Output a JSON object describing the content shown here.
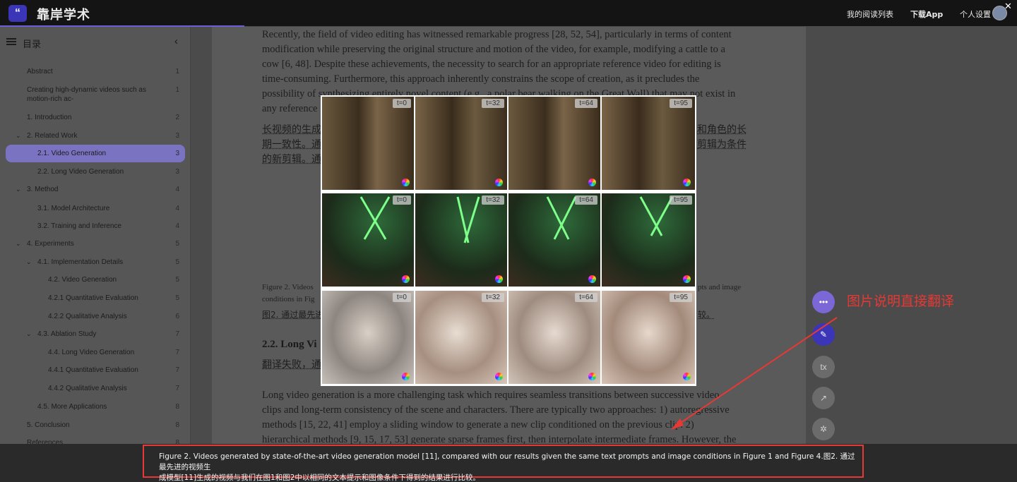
{
  "header": {
    "app_name": "靠岸学术",
    "logo_glyph": "“",
    "reading_list": "我的阅读列表",
    "download_app": "下载App",
    "settings": "个人设置"
  },
  "sidebar": {
    "title": "目录",
    "items": [
      {
        "label": "Abstract",
        "page": "1"
      },
      {
        "label": "Creating high-dynamic videos such as motion-rich ac-",
        "page": "1"
      },
      {
        "label": "1. Introduction",
        "page": "2"
      },
      {
        "label": "2. Related Work",
        "page": "3"
      },
      {
        "label": "2.1. Video Generation",
        "page": "3"
      },
      {
        "label": "2.2. Long Video Generation",
        "page": "3"
      },
      {
        "label": "3. Method",
        "page": "4"
      },
      {
        "label": "3.1. Model Architecture",
        "page": "4"
      },
      {
        "label": "3.2. Training and Inference",
        "page": "4"
      },
      {
        "label": "4. Experiments",
        "page": "5"
      },
      {
        "label": "4.1. Implementation Details",
        "page": "5"
      },
      {
        "label": "4.2. Video Generation",
        "page": "5"
      },
      {
        "label": "4.2.1 Quantitative Evaluation",
        "page": "5"
      },
      {
        "label": "4.2.2 Qualitative Analysis",
        "page": "6"
      },
      {
        "label": "4.3. Ablation Study",
        "page": "7"
      },
      {
        "label": "4.4. Long Video Generation",
        "page": "7"
      },
      {
        "label": "4.4.1 Quantitative Evaluation",
        "page": "7"
      },
      {
        "label": "4.4.2 Qualitative Analysis",
        "page": "7"
      },
      {
        "label": "4.5. More Applications",
        "page": "8"
      },
      {
        "label": "5. Conclusion",
        "page": "8"
      },
      {
        "label": "References",
        "page": "8"
      }
    ]
  },
  "document": {
    "p1_lines": [
      "Recently, the field of video editing has witnessed remarkable progress [28, 52, 54], particularly in terms of content",
      "modification while preserving the original structure and motion of the video, for example, modifying a cattle to a",
      "cow [6, 48]. Despite these achievements, the necessity to search for an appropriate reference video for editing is",
      "time-consuming. Furthermore, this approach inherently constrains the scope of creation, as it precludes the",
      "possibility of synthesizing entirely novel content (e.g., a polar bear walking on the Great Wall) that may not exist in",
      "any reference"
    ],
    "zh1_lines": [
      "长视频的生成",
      "期一致性。通",
      "的新剪辑。通"
    ],
    "zh1_right_lines": [
      "和角色的长",
      "剪辑为条件"
    ],
    "fig_caption_lines": [
      "Figure 2. Videos",
      "conditions in Fig"
    ],
    "fig_caption_right": "pts and image",
    "fig_zh_left": "图2. 通过最先进",
    "fig_zh_right": "较。",
    "section_heading": "2.2. Long Vi",
    "fail_text": "翻译失败，通",
    "p2_lines": [
      "Long video generation is a more challenging task which requires seamless transitions between successive video",
      "clips and long-term consistency of the scene and characters. There are typically two approaches: 1) autoregressive",
      "methods [15, 22, 41] employ a sliding window to generate a new clip conditioned on the previous clip. 2)",
      "hierarchical methods [9, 15, 17, 53] generate sparse frames first, then interpolate intermediate frames. However, the"
    ]
  },
  "figure": {
    "time_labels": [
      "t=0",
      "t=32",
      "t=64",
      "t=95"
    ],
    "rows": [
      "bronze-statues",
      "cat-jedi-lightsabers",
      "girl-portrait-sketch"
    ]
  },
  "annotation": {
    "text": "图片说明直接翻译"
  },
  "tools": [
    "chat-icon",
    "magic-wand-icon",
    "translate-icon",
    "open-external-icon",
    "bug-icon"
  ],
  "tools_tx_label": "tx",
  "bottom_caption": {
    "line1": "Figure 2. Videos generated by state-of-the-art video generation model [11], compared with our results given the same text prompts and image conditions in Figure 1 and Figure 4.图2. 通过最先进的视频生",
    "line2": "成模型[11]生成的视频与我们在图1和图2中以相同的文本提示和图像条件下得到的结果进行比较。"
  },
  "colors": {
    "accent": "#3b35b8",
    "active_item": "#7a73c2",
    "annotation_red": "#e53935"
  }
}
